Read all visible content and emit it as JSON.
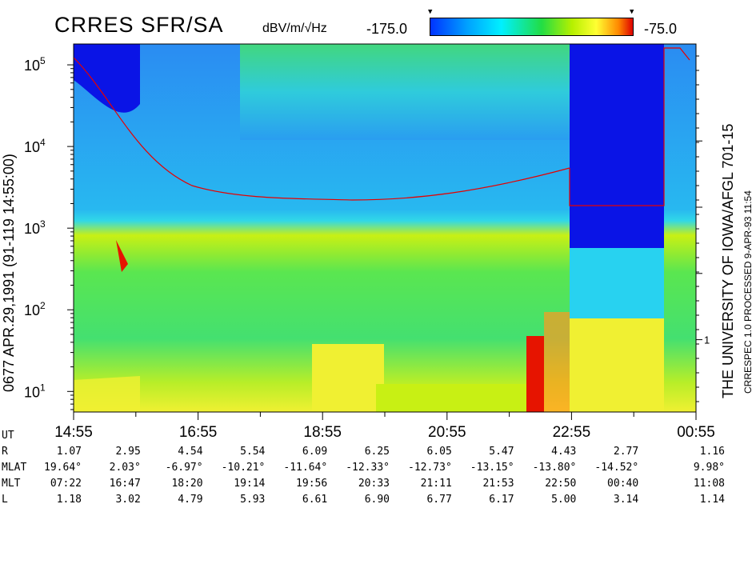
{
  "header": {
    "title": "CRRES SFR/SA",
    "units": "dBV/m/√Hz",
    "colorbar_min": "-175.0",
    "colorbar_max": "-75.0"
  },
  "side_labels": {
    "left": "0677   APR.29,1991   (91-119 14:55:00)",
    "right_main": "THE UNIVERSITY OF IOWA/AFGL 701-15",
    "right_small": "CRRESPEC 1.0   PROCESSED 9-APR-93  11:54"
  },
  "colors": {
    "deep_blue": "#0a14e6",
    "blue": "#1e78f0",
    "cyan": "#28d2f0",
    "green": "#3ce650",
    "yellow_green": "#c8f014",
    "yellow": "#f0f032",
    "orange": "#ff8c00",
    "red": "#e61400",
    "cyclotron_line": "#e60000"
  },
  "chart_data": {
    "type": "heatmap",
    "title": "CRRES SFR/SA",
    "x_axis": {
      "label": "UT",
      "tick_labels": [
        "14:55",
        "16:55",
        "18:55",
        "20:55",
        "22:55",
        "00:55"
      ],
      "range_hours": [
        0,
        10
      ]
    },
    "y_axis": {
      "label": "",
      "scale": "log",
      "range": [
        5.6,
        40000
      ],
      "tick_labels": [
        "10^1",
        "10^2",
        "10^3",
        "10^4",
        "10^5"
      ],
      "tick_values": [
        10,
        100,
        1000,
        10000,
        100000
      ]
    },
    "right_axis": {
      "tick_labels": [
        "1",
        "",
        "",
        ""
      ],
      "tick_positions_frac": [
        0.24,
        0.42,
        0.6,
        0.78
      ]
    },
    "colorbar": {
      "label": "dBV/m/√Hz",
      "min": -175.0,
      "max": -75.0
    },
    "ephemeris": {
      "rows": [
        "R",
        "MLAT",
        "MLT",
        "L"
      ],
      "columns": [
        {
          "R": "1.07",
          "MLAT": "19.64°",
          "MLT": "07:22",
          "L": "1.18"
        },
        {
          "R": "2.95",
          "MLAT": "2.03°",
          "MLT": "16:47",
          "L": "3.02"
        },
        {
          "R": "4.54",
          "MLAT": "-6.97°",
          "MLT": "18:20",
          "L": "4.79"
        },
        {
          "R": "5.54",
          "MLAT": "-10.21°",
          "MLT": "19:14",
          "L": "5.93"
        },
        {
          "R": "6.09",
          "MLAT": "-11.64°",
          "MLT": "19:56",
          "L": "6.61"
        },
        {
          "R": "6.25",
          "MLAT": "-12.33°",
          "MLT": "20:33",
          "L": "6.90"
        },
        {
          "R": "6.05",
          "MLAT": "-12.73°",
          "MLT": "21:11",
          "L": "6.77"
        },
        {
          "R": "5.47",
          "MLAT": "-13.15°",
          "MLT": "21:53",
          "L": "6.17"
        },
        {
          "R": "4.43",
          "MLAT": "-13.80°",
          "MLT": "22:50",
          "L": "5.00"
        },
        {
          "R": "2.77",
          "MLAT": "-14.52°",
          "MLT": "00:40",
          "L": "3.14"
        },
        {
          "R": "1.16",
          "MLAT": "9.98°",
          "MLT": "11:08",
          "L": "1.14"
        }
      ]
    }
  }
}
